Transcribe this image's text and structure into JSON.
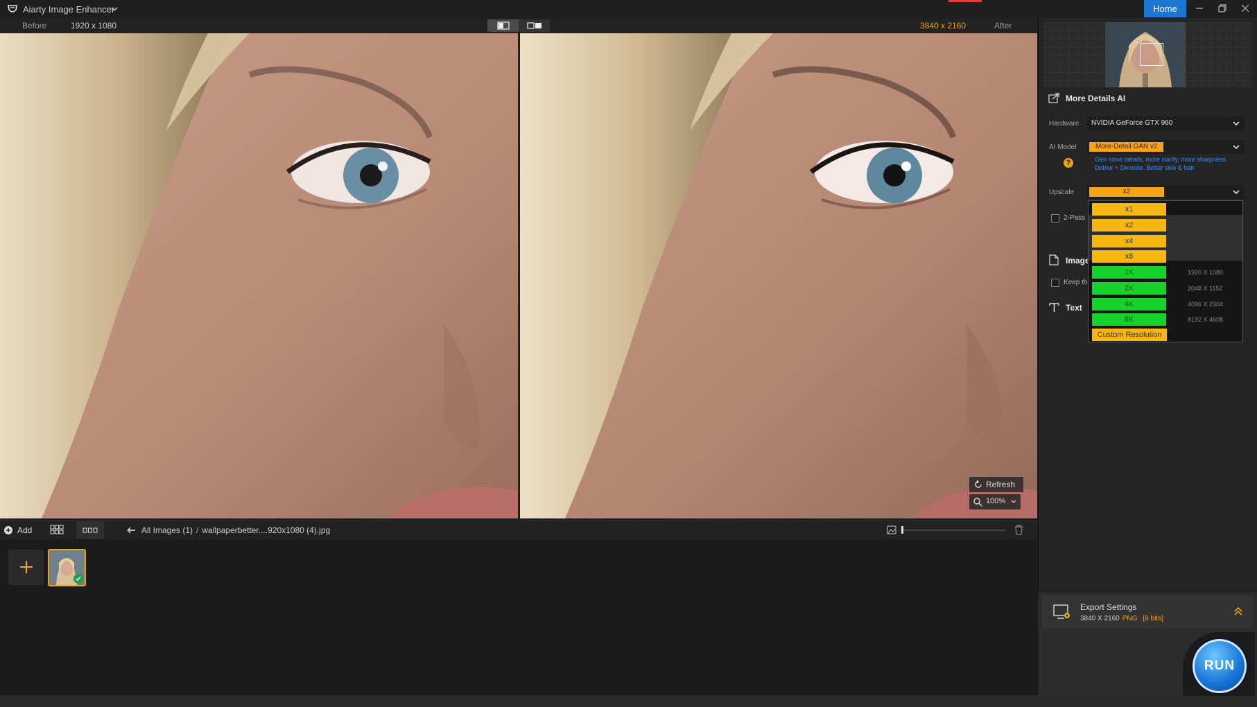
{
  "app": {
    "title": "Aiarty Image Enhancer",
    "home_label": "Home"
  },
  "compare": {
    "before_label": "Before",
    "before_resolution": "1920 x 1080",
    "after_resolution": "3840 x 2160",
    "after_label": "After"
  },
  "viewer": {
    "refresh_label": "Refresh",
    "zoom_value": "100%"
  },
  "bottom": {
    "add_label": "Add",
    "breadcrumb_root": "All Images (1)",
    "breadcrumb_sep": "/",
    "breadcrumb_file": "wallpaperbetter....920x1080 (4).jpg"
  },
  "panel": {
    "section_title": "More Details AI",
    "hardware_label": "Hardware",
    "hardware_value": "NVIDIA GeForce GTX 960",
    "model_label": "AI Model",
    "model_value": "More-Detail GAN v2",
    "model_desc": "Gen more details, more clarity, more sharpness. Deblur + Denoise. Better skin & hair.",
    "upscale_label": "Upscale",
    "upscale_value": "x2",
    "twopass_label": "2-Pass",
    "image_section": "Image",
    "keep_label": "Keep th",
    "text_section": "Text"
  },
  "upscale_options": [
    {
      "label": "x1",
      "kind": "orange",
      "dims": ""
    },
    {
      "label": "x2",
      "kind": "orange",
      "dims": ""
    },
    {
      "label": "x4",
      "kind": "orange",
      "dims": ""
    },
    {
      "label": "x8",
      "kind": "orange",
      "dims": ""
    },
    {
      "label": "1K",
      "kind": "green",
      "dims": "1920 X 1080"
    },
    {
      "label": "2K",
      "kind": "green",
      "dims": "2048 X 1152"
    },
    {
      "label": "4K",
      "kind": "green",
      "dims": "4096 X 2304"
    },
    {
      "label": "8K",
      "kind": "green",
      "dims": "8192 X 4608"
    },
    {
      "label": "Custom Resolution",
      "kind": "custom",
      "dims": ""
    }
  ],
  "export": {
    "title": "Export Settings",
    "resolution": "3840 X 2160",
    "format": "PNG",
    "bits": "[8 bits]"
  },
  "run_label": "RUN",
  "colors": {
    "accent_orange": "#f6a317",
    "accent_green": "#18d22c",
    "home_blue": "#1976d2",
    "desc_blue": "#3c8ee8"
  }
}
